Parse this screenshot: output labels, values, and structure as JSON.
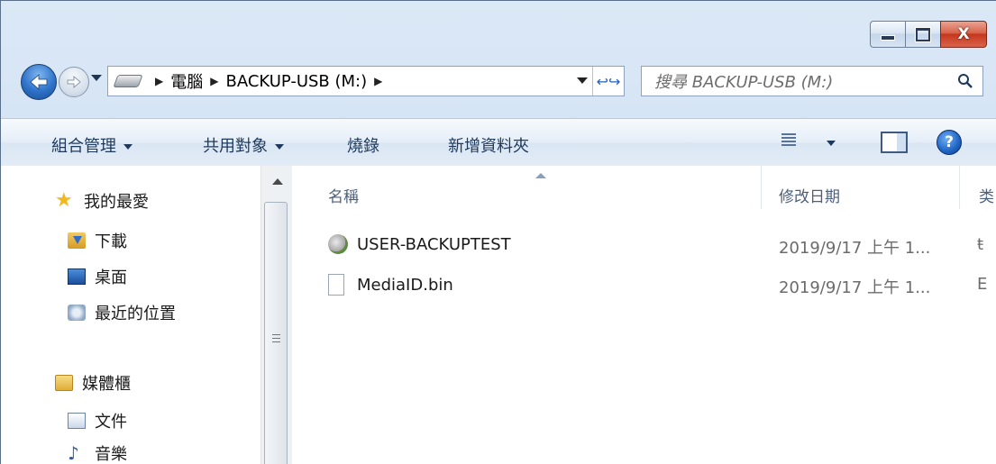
{
  "window": {
    "caption": {
      "minimize": "–",
      "maximize": "□",
      "close": "X"
    }
  },
  "nav": {
    "breadcrumb": [
      "電腦",
      "BACKUP-USB (M:)"
    ],
    "search_placeholder": "搜尋 BACKUP-USB (M:)"
  },
  "toolbar": {
    "organize": "組合管理",
    "share": "共用對象",
    "burn": "燒錄",
    "new_folder": "新增資料夾",
    "help": "?"
  },
  "sidebar": {
    "favorites": {
      "label": "我的最愛",
      "items": [
        "下載",
        "桌面",
        "最近的位置"
      ]
    },
    "libraries": {
      "label": "媒體櫃",
      "items": [
        "文件",
        "音樂"
      ]
    }
  },
  "files": {
    "columns": {
      "name": "名稱",
      "modified": "修改日期",
      "type": "类"
    },
    "rows": [
      {
        "name": "USER-BACKUPTEST",
        "modified": "2019/9/17 上午 1...",
        "type": "ŧ",
        "icon": "backup-icon"
      },
      {
        "name": "MediaID.bin",
        "modified": "2019/9/17 上午 1...",
        "type": "E",
        "icon": "file-icon"
      }
    ]
  }
}
